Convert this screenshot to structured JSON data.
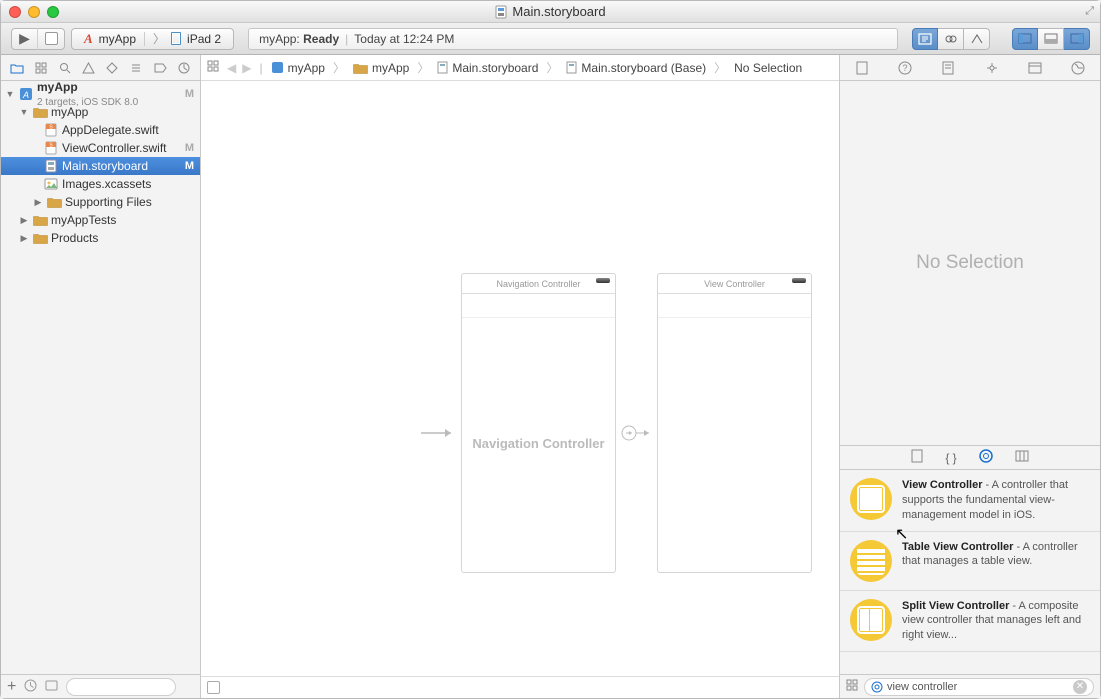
{
  "window": {
    "title": "Main.storyboard"
  },
  "scheme": {
    "target": "myApp",
    "device": "iPad 2"
  },
  "status": {
    "left": "myApp:",
    "state": "Ready",
    "right": "Today at 12:24 PM"
  },
  "tree": {
    "project": {
      "name": "myApp",
      "sub": "2 targets, iOS SDK 8.0",
      "badge": "M"
    },
    "group_myapp": "myApp",
    "appdelegate": "AppDelegate.swift",
    "viewcontroller": {
      "name": "ViewController.swift",
      "badge": "M"
    },
    "mainsb": {
      "name": "Main.storyboard",
      "badge": "M"
    },
    "images": "Images.xcassets",
    "supporting": "Supporting Files",
    "tests": "myAppTests",
    "products": "Products"
  },
  "jumpbar": {
    "p1": "myApp",
    "p2": "myApp",
    "p3": "Main.storyboard",
    "p4": "Main.storyboard (Base)",
    "p5": "No Selection"
  },
  "canvas": {
    "scene1_title": "Navigation Controller",
    "scene1_body": "Navigation Controller",
    "scene2_title": "View Controller"
  },
  "inspector": {
    "no_selection": "No Selection"
  },
  "library": {
    "item1": {
      "title": "View Controller",
      "desc": " - A controller that supports the fundamental view-management model in iOS."
    },
    "item2": {
      "title": "Table View Controller",
      "desc": " - A controller that manages a table view."
    },
    "item3": {
      "title": "Split View Controller",
      "desc": " - A composite view controller that manages left and right view..."
    },
    "search": "view controller"
  }
}
